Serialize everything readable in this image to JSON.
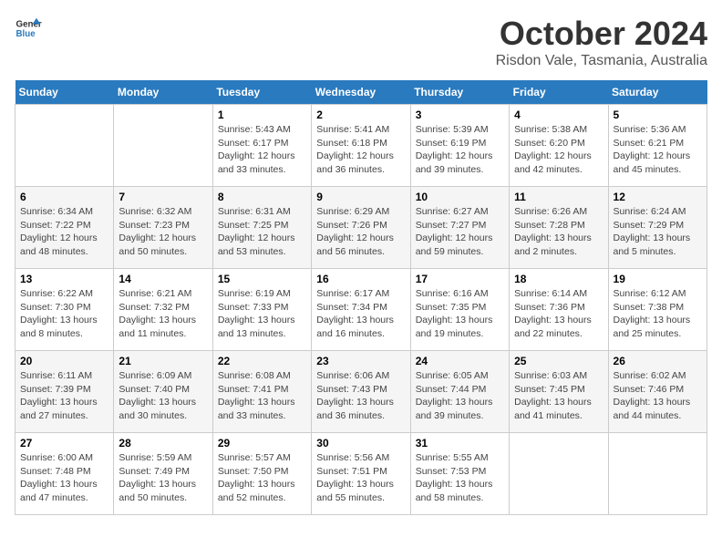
{
  "header": {
    "logo_general": "General",
    "logo_blue": "Blue",
    "month_title": "October 2024",
    "location": "Risdon Vale, Tasmania, Australia"
  },
  "weekdays": [
    "Sunday",
    "Monday",
    "Tuesday",
    "Wednesday",
    "Thursday",
    "Friday",
    "Saturday"
  ],
  "weeks": [
    [
      {
        "day": "",
        "sunrise": "",
        "sunset": "",
        "daylight": ""
      },
      {
        "day": "",
        "sunrise": "",
        "sunset": "",
        "daylight": ""
      },
      {
        "day": "1",
        "sunrise": "Sunrise: 5:43 AM",
        "sunset": "Sunset: 6:17 PM",
        "daylight": "Daylight: 12 hours and 33 minutes."
      },
      {
        "day": "2",
        "sunrise": "Sunrise: 5:41 AM",
        "sunset": "Sunset: 6:18 PM",
        "daylight": "Daylight: 12 hours and 36 minutes."
      },
      {
        "day": "3",
        "sunrise": "Sunrise: 5:39 AM",
        "sunset": "Sunset: 6:19 PM",
        "daylight": "Daylight: 12 hours and 39 minutes."
      },
      {
        "day": "4",
        "sunrise": "Sunrise: 5:38 AM",
        "sunset": "Sunset: 6:20 PM",
        "daylight": "Daylight: 12 hours and 42 minutes."
      },
      {
        "day": "5",
        "sunrise": "Sunrise: 5:36 AM",
        "sunset": "Sunset: 6:21 PM",
        "daylight": "Daylight: 12 hours and 45 minutes."
      }
    ],
    [
      {
        "day": "6",
        "sunrise": "Sunrise: 6:34 AM",
        "sunset": "Sunset: 7:22 PM",
        "daylight": "Daylight: 12 hours and 48 minutes."
      },
      {
        "day": "7",
        "sunrise": "Sunrise: 6:32 AM",
        "sunset": "Sunset: 7:23 PM",
        "daylight": "Daylight: 12 hours and 50 minutes."
      },
      {
        "day": "8",
        "sunrise": "Sunrise: 6:31 AM",
        "sunset": "Sunset: 7:25 PM",
        "daylight": "Daylight: 12 hours and 53 minutes."
      },
      {
        "day": "9",
        "sunrise": "Sunrise: 6:29 AM",
        "sunset": "Sunset: 7:26 PM",
        "daylight": "Daylight: 12 hours and 56 minutes."
      },
      {
        "day": "10",
        "sunrise": "Sunrise: 6:27 AM",
        "sunset": "Sunset: 7:27 PM",
        "daylight": "Daylight: 12 hours and 59 minutes."
      },
      {
        "day": "11",
        "sunrise": "Sunrise: 6:26 AM",
        "sunset": "Sunset: 7:28 PM",
        "daylight": "Daylight: 13 hours and 2 minutes."
      },
      {
        "day": "12",
        "sunrise": "Sunrise: 6:24 AM",
        "sunset": "Sunset: 7:29 PM",
        "daylight": "Daylight: 13 hours and 5 minutes."
      }
    ],
    [
      {
        "day": "13",
        "sunrise": "Sunrise: 6:22 AM",
        "sunset": "Sunset: 7:30 PM",
        "daylight": "Daylight: 13 hours and 8 minutes."
      },
      {
        "day": "14",
        "sunrise": "Sunrise: 6:21 AM",
        "sunset": "Sunset: 7:32 PM",
        "daylight": "Daylight: 13 hours and 11 minutes."
      },
      {
        "day": "15",
        "sunrise": "Sunrise: 6:19 AM",
        "sunset": "Sunset: 7:33 PM",
        "daylight": "Daylight: 13 hours and 13 minutes."
      },
      {
        "day": "16",
        "sunrise": "Sunrise: 6:17 AM",
        "sunset": "Sunset: 7:34 PM",
        "daylight": "Daylight: 13 hours and 16 minutes."
      },
      {
        "day": "17",
        "sunrise": "Sunrise: 6:16 AM",
        "sunset": "Sunset: 7:35 PM",
        "daylight": "Daylight: 13 hours and 19 minutes."
      },
      {
        "day": "18",
        "sunrise": "Sunrise: 6:14 AM",
        "sunset": "Sunset: 7:36 PM",
        "daylight": "Daylight: 13 hours and 22 minutes."
      },
      {
        "day": "19",
        "sunrise": "Sunrise: 6:12 AM",
        "sunset": "Sunset: 7:38 PM",
        "daylight": "Daylight: 13 hours and 25 minutes."
      }
    ],
    [
      {
        "day": "20",
        "sunrise": "Sunrise: 6:11 AM",
        "sunset": "Sunset: 7:39 PM",
        "daylight": "Daylight: 13 hours and 27 minutes."
      },
      {
        "day": "21",
        "sunrise": "Sunrise: 6:09 AM",
        "sunset": "Sunset: 7:40 PM",
        "daylight": "Daylight: 13 hours and 30 minutes."
      },
      {
        "day": "22",
        "sunrise": "Sunrise: 6:08 AM",
        "sunset": "Sunset: 7:41 PM",
        "daylight": "Daylight: 13 hours and 33 minutes."
      },
      {
        "day": "23",
        "sunrise": "Sunrise: 6:06 AM",
        "sunset": "Sunset: 7:43 PM",
        "daylight": "Daylight: 13 hours and 36 minutes."
      },
      {
        "day": "24",
        "sunrise": "Sunrise: 6:05 AM",
        "sunset": "Sunset: 7:44 PM",
        "daylight": "Daylight: 13 hours and 39 minutes."
      },
      {
        "day": "25",
        "sunrise": "Sunrise: 6:03 AM",
        "sunset": "Sunset: 7:45 PM",
        "daylight": "Daylight: 13 hours and 41 minutes."
      },
      {
        "day": "26",
        "sunrise": "Sunrise: 6:02 AM",
        "sunset": "Sunset: 7:46 PM",
        "daylight": "Daylight: 13 hours and 44 minutes."
      }
    ],
    [
      {
        "day": "27",
        "sunrise": "Sunrise: 6:00 AM",
        "sunset": "Sunset: 7:48 PM",
        "daylight": "Daylight: 13 hours and 47 minutes."
      },
      {
        "day": "28",
        "sunrise": "Sunrise: 5:59 AM",
        "sunset": "Sunset: 7:49 PM",
        "daylight": "Daylight: 13 hours and 50 minutes."
      },
      {
        "day": "29",
        "sunrise": "Sunrise: 5:57 AM",
        "sunset": "Sunset: 7:50 PM",
        "daylight": "Daylight: 13 hours and 52 minutes."
      },
      {
        "day": "30",
        "sunrise": "Sunrise: 5:56 AM",
        "sunset": "Sunset: 7:51 PM",
        "daylight": "Daylight: 13 hours and 55 minutes."
      },
      {
        "day": "31",
        "sunrise": "Sunrise: 5:55 AM",
        "sunset": "Sunset: 7:53 PM",
        "daylight": "Daylight: 13 hours and 58 minutes."
      },
      {
        "day": "",
        "sunrise": "",
        "sunset": "",
        "daylight": ""
      },
      {
        "day": "",
        "sunrise": "",
        "sunset": "",
        "daylight": ""
      }
    ]
  ]
}
